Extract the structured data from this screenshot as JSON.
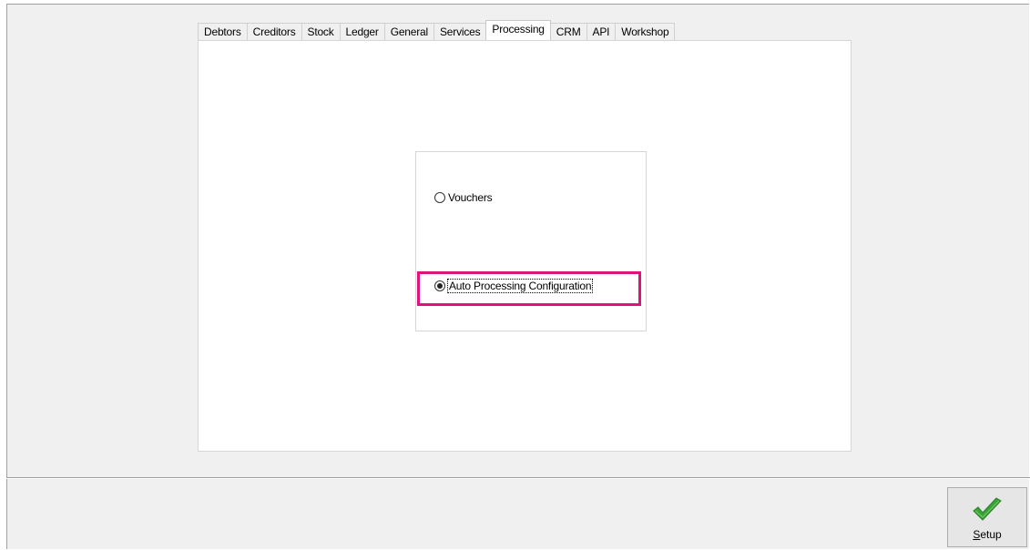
{
  "tabs": [
    {
      "label": "Debtors",
      "active": false
    },
    {
      "label": "Creditors",
      "active": false
    },
    {
      "label": "Stock",
      "active": false
    },
    {
      "label": "Ledger",
      "active": false
    },
    {
      "label": "General",
      "active": false
    },
    {
      "label": "Services",
      "active": false
    },
    {
      "label": "Processing",
      "active": true
    },
    {
      "label": "CRM",
      "active": false
    },
    {
      "label": "API",
      "active": false
    },
    {
      "label": "Workshop",
      "active": false
    }
  ],
  "options": {
    "vouchers": {
      "label": "Vouchers",
      "checked": false
    },
    "auto_processing": {
      "label": "Auto Processing Configuration",
      "checked": true
    }
  },
  "highlight_color": "#e0127d",
  "setup_button": {
    "mnemonic": "S",
    "rest": "etup",
    "icon": "green-checkmark-icon",
    "icon_color": "#3aa335"
  }
}
